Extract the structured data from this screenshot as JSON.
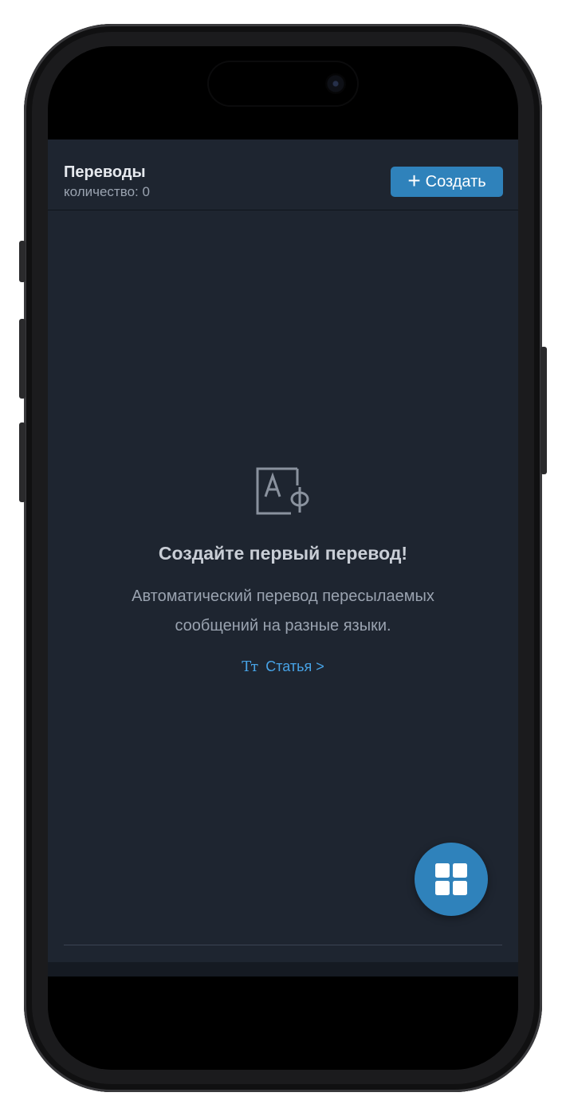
{
  "header": {
    "title": "Переводы",
    "count_label": "количество: 0",
    "create_button": {
      "label": "Создать",
      "icon": "plus-icon"
    }
  },
  "empty_state": {
    "icon": "translate-icon",
    "title": "Создайте первый перевод!",
    "description": "Автоматический перевод пересылаемых сообщений на разные языки.",
    "link": {
      "icon": "text-size-icon",
      "icon_glyph": "Tт",
      "label": "Статья >"
    }
  },
  "fab": {
    "icon": "grid-icon"
  },
  "colors": {
    "background": "#1e2530",
    "accent": "#2f82bb",
    "link": "#47a3e6",
    "title_text": "#e6e9ee",
    "muted_text": "#9aa3b0"
  }
}
